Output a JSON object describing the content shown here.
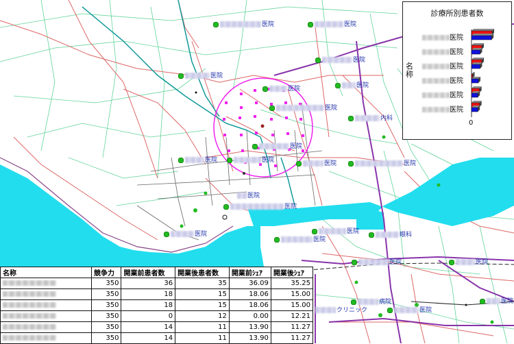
{
  "map": {
    "labels": [
      {
        "suffix": "医院",
        "blur_w": 60
      },
      {
        "suffix": "医院",
        "blur_w": 42
      },
      {
        "suffix": "医院",
        "blur_w": 44
      },
      {
        "suffix": "医院",
        "blur_w": 36
      },
      {
        "suffix": "医院",
        "blur_w": 20
      },
      {
        "suffix": "医院",
        "blur_w": 26
      },
      {
        "suffix": "医院",
        "blur_w": 70
      },
      {
        "suffix": "内科",
        "blur_w": 36
      },
      {
        "suffix": "医院",
        "blur_w": 44
      },
      {
        "suffix": "医院",
        "blur_w": 28
      },
      {
        "suffix": "医院",
        "blur_w": 40
      },
      {
        "suffix": "医院",
        "blur_w": 30
      },
      {
        "suffix": "医院",
        "blur_w": 70
      },
      {
        "suffix": "医院",
        "blur_w": 14
      },
      {
        "suffix": "医院",
        "blur_w": 78
      },
      {
        "suffix": "医院",
        "blur_w": 34
      },
      {
        "suffix": "医院",
        "blur_w": 40
      },
      {
        "suffix": "医院",
        "blur_w": 46
      },
      {
        "suffix": "眼科",
        "blur_w": 34
      },
      {
        "suffix": "医院",
        "blur_w": 44
      },
      {
        "suffix": "医院",
        "blur_w": 28
      },
      {
        "suffix": "病院",
        "blur_w": 30
      },
      {
        "suffix": "クリニック",
        "blur_w": 30
      },
      {
        "suffix": "医院",
        "blur_w": 36
      },
      {
        "suffix": "医院",
        "blur_w": 20
      }
    ]
  },
  "chart_data": {
    "type": "bar",
    "title": "診療所別患者数",
    "ylabel": "名称",
    "tick_zero": "0",
    "orientation": "horizontal",
    "categories": [
      {
        "suffix": "医院"
      },
      {
        "suffix": "医院"
      },
      {
        "suffix": "医院"
      },
      {
        "suffix": "医院"
      },
      {
        "suffix": "医院"
      },
      {
        "suffix": "医院"
      }
    ],
    "series": [
      {
        "name": "開業前患者数",
        "color": "#ee1111",
        "values": [
          36,
          18,
          18,
          0,
          14,
          14
        ]
      },
      {
        "name": "開業後患者数",
        "color": "#1111dd",
        "values": [
          35,
          15,
          15,
          12,
          11,
          11
        ]
      }
    ],
    "xlim": [
      0,
      36
    ]
  },
  "table": {
    "headers": [
      "名称",
      "競争力",
      "開業前患者数",
      "開業後患者数",
      "開業前ｼｪｱ",
      "開業後ｼｪｱ"
    ],
    "rows": [
      [
        "",
        "350",
        "36",
        "35",
        "36.09",
        "35.25"
      ],
      [
        "",
        "350",
        "18",
        "15",
        "18.06",
        "15.00"
      ],
      [
        "",
        "350",
        "18",
        "15",
        "18.06",
        "15.00"
      ],
      [
        "",
        "350",
        "0",
        "12",
        "0.00",
        "12.21"
      ],
      [
        "",
        "350",
        "14",
        "11",
        "13.90",
        "11.27"
      ],
      [
        "",
        "350",
        "14",
        "11",
        "13.90",
        "11.27"
      ]
    ]
  },
  "colors": {
    "sea": "#22ddee",
    "road_red": "#dd5555",
    "road_green": "#44cc88",
    "rail": "#8833aa",
    "circle": "#ee22ee",
    "river_teal": "#119999"
  }
}
